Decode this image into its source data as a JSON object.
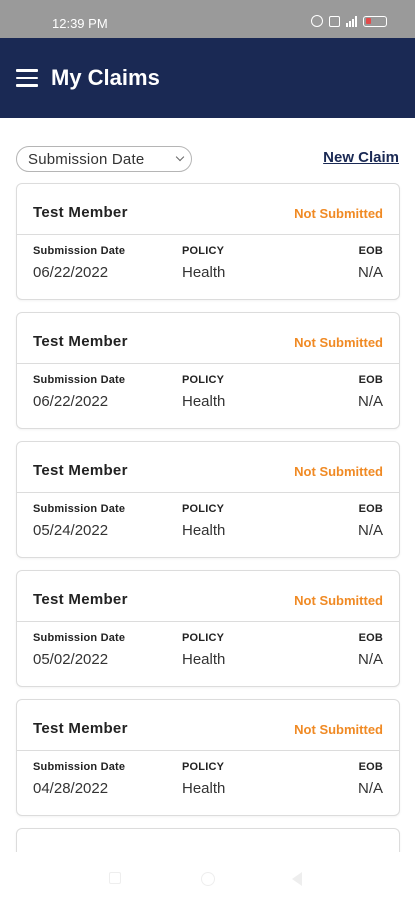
{
  "status_bar": {
    "time": "12:39 PM"
  },
  "app_bar": {
    "title": "My Claims"
  },
  "controls": {
    "sort_selected": "Submission Date",
    "new_claim_label": "New Claim"
  },
  "claims": [
    {
      "member": "Test Member",
      "status": "Not Submitted",
      "submission_date_label": "Submission Date",
      "policy_label": "POLICY",
      "eob_label": "EOB",
      "submission_date": "06/22/2022",
      "policy": "Health",
      "eob": "N/A"
    },
    {
      "member": "Test Member",
      "status": "Not Submitted",
      "submission_date_label": "Submission Date",
      "policy_label": "POLICY",
      "eob_label": "EOB",
      "submission_date": "06/22/2022",
      "policy": "Health",
      "eob": "N/A"
    },
    {
      "member": "Test Member",
      "status": "Not Submitted",
      "submission_date_label": "Submission Date",
      "policy_label": "POLICY",
      "eob_label": "EOB",
      "submission_date": "05/24/2022",
      "policy": "Health",
      "eob": "N/A"
    },
    {
      "member": "Test Member",
      "status": "Not Submitted",
      "submission_date_label": "Submission Date",
      "policy_label": "POLICY",
      "eob_label": "EOB",
      "submission_date": "05/02/2022",
      "policy": "Health",
      "eob": "N/A"
    },
    {
      "member": "Test Member",
      "status": "Not Submitted",
      "submission_date_label": "Submission Date",
      "policy_label": "POLICY",
      "eob_label": "EOB",
      "submission_date": "04/28/2022",
      "policy": "Health",
      "eob": "N/A"
    }
  ],
  "colors": {
    "header": "#1a2954",
    "status_pending": "#f08a24",
    "status_bar": "#9a9a9a"
  }
}
